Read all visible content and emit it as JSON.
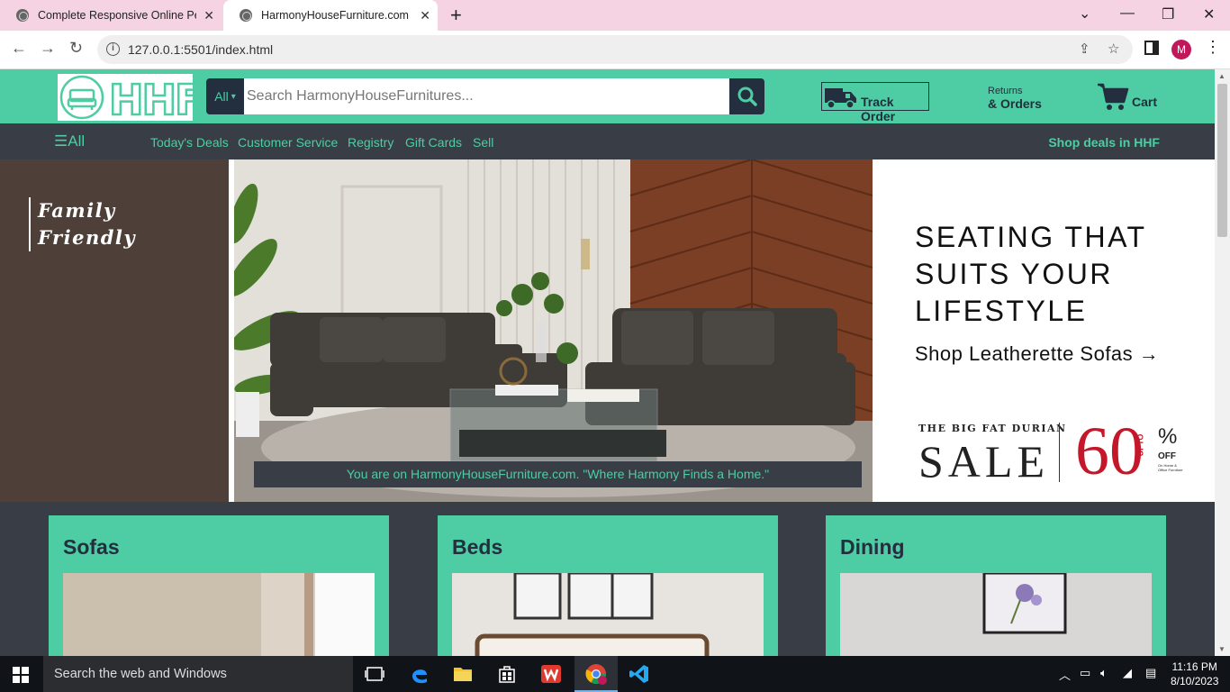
{
  "browser": {
    "tabs": [
      {
        "title": "Complete Responsive Online Perf",
        "active": false
      },
      {
        "title": "HarmonyHouseFurniture.com",
        "active": true
      }
    ],
    "url": "127.0.0.1:5501/index.html",
    "profile_initial": "M"
  },
  "header": {
    "logo_text": "HHF",
    "search_category": "All",
    "search_placeholder": "Search HarmonyHouseFurnitures...",
    "track_order": "Track Order",
    "returns_line1": "Returns",
    "returns_line2": "& Orders",
    "cart": "Cart"
  },
  "nav": {
    "all": "All",
    "items": [
      "Today's Deals",
      "Customer Service",
      "Registry",
      "Gift Cards",
      "Sell"
    ],
    "deals": "Shop deals in HHF"
  },
  "hero": {
    "side_text_line1": "Family",
    "side_text_line2": "Friendly",
    "message": "You are on HarmonyHouseFurniture.com. \"Where Harmony Finds a Home.\"",
    "promo_line1": "SEATING THAT",
    "promo_line2": "SUITS YOUR",
    "promo_line3": "LIFESTYLE",
    "promo_link": "Shop Leatherette Sofas",
    "sale_top": "THE BIG FAT DURIAN",
    "sale_word": "SALE",
    "sale_upto": "UPTO",
    "sale_number": "60",
    "sale_percent": "%",
    "sale_off": "OFF",
    "sale_fine": "On Home & Office Furniture"
  },
  "categories": [
    {
      "title": "Sofas"
    },
    {
      "title": "Beds"
    },
    {
      "title": "Dining"
    }
  ],
  "taskbar": {
    "search_placeholder": "Search the web and Windows",
    "time": "11:16 PM",
    "date": "8/10/2023"
  },
  "colors": {
    "accent": "#4ecca3",
    "dark": "#393e46",
    "navy": "#232f3e",
    "sale_red": "#c4182a",
    "tab_bar": "#f6d3e3"
  }
}
